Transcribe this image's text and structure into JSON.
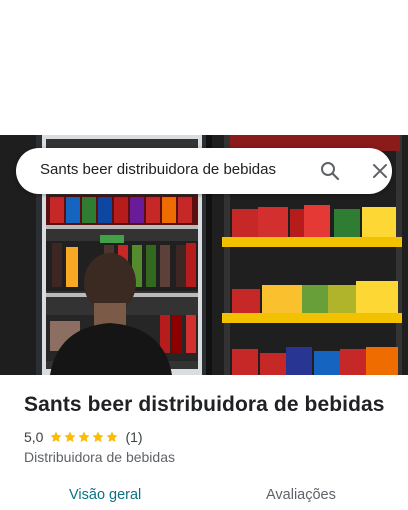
{
  "search": {
    "query": "Sants beer distribuidora de bebidas"
  },
  "place": {
    "name": "Sants beer distribuidora de bebidas",
    "rating_value": "5,0",
    "star_count": 5,
    "review_count": "(1)",
    "category": "Distribuidora de bebidas"
  },
  "tabs": {
    "overview": "Visão geral",
    "reviews": "Avaliações"
  },
  "icons": {
    "search": "search-icon",
    "close": "close-icon",
    "star": "star-icon"
  },
  "colors": {
    "star": "#fbbc04",
    "active_tab": "#0b7285",
    "inactive_tab": "#5f6368"
  }
}
